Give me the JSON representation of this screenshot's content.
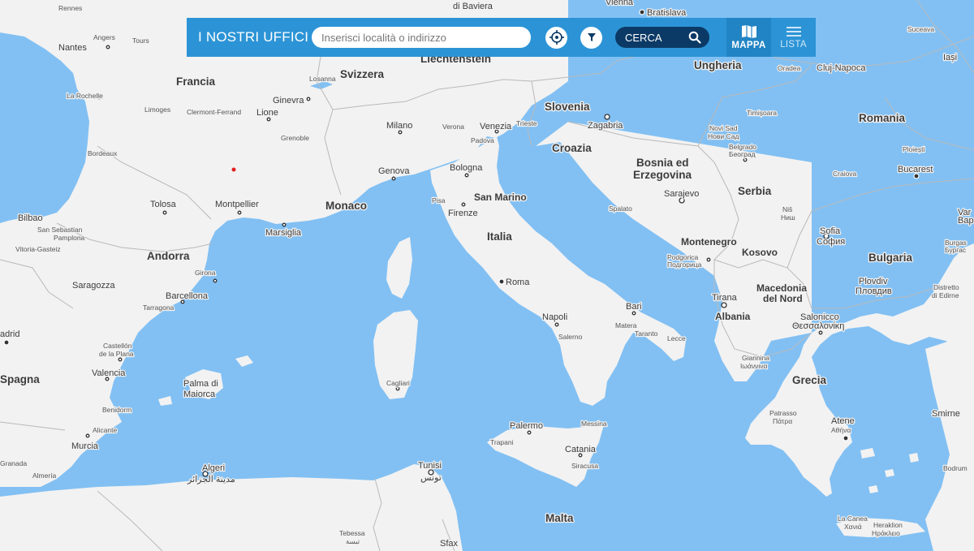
{
  "header": {
    "title": "I NOSTRI UFFICI",
    "search_placeholder": "Inserisci località o indirizzo",
    "search_value": "",
    "cerca_label": "CERCA",
    "tabs": [
      {
        "label": "MAPPA",
        "icon": "map-book-icon",
        "active": true
      },
      {
        "label": "LISTA",
        "icon": "list-icon",
        "active": false
      }
    ],
    "colors": {
      "bar": "#2c94d6",
      "cerca": "#0b3a66",
      "sea": "#82c0f3",
      "land": "#f2f2f2"
    }
  },
  "map": {
    "countries": {
      "francia": "Francia",
      "svizzera": "Svizzera",
      "liechtenstein": "Liechtenstein",
      "ungheria": "Ungheria",
      "romania": "Romania",
      "slovenia": "Slovenia",
      "croazia": "Croazia",
      "bosnia1": "Bosnia ed",
      "bosnia2": "Erzegovina",
      "serbia": "Serbia",
      "monaco": "Monaco",
      "sanmarino": "San Marino",
      "italia": "Italia",
      "andorra": "Andorra",
      "spagna": "Spagna",
      "montenegro": "Montenegro",
      "kosovo": "Kosovo",
      "bulgaria": "Bulgaria",
      "macedonia1": "Macedonia",
      "macedonia2": "del Nord",
      "albania": "Albania",
      "grecia": "Grecia",
      "malta": "Malta"
    },
    "cities": {
      "rennes": "Rennes",
      "dibaviera": "di Baviera",
      "vienna": "Vienna",
      "bratislava": "Bratislava",
      "suceava": "Suceava",
      "iasi": "Iași",
      "angers": "Angers",
      "tours": "Tours",
      "nantes": "Nantes",
      "oradea": "Oradea",
      "clujnapoca": "Cluj-Napoca",
      "losanna": "Losanna",
      "larochelle": "La Rochelle",
      "limoges": "Limoges",
      "clermont": "Clermont-Ferrand",
      "lione": "Lione",
      "ginevra": "Ginevra",
      "milano": "Milano",
      "verona": "Verona",
      "venezia": "Venezia",
      "trieste": "Trieste",
      "padova": "Padova",
      "zagabria": "Zagabria",
      "timisoara": "Timișoara",
      "novisad": "Novi Sad",
      "novisad_n": "Нови Сад",
      "belgrado": "Belgrado",
      "belgrado_n": "Београд",
      "grenoble": "Grenoble",
      "bordeaux": "Bordeaux",
      "genova": "Genova",
      "bologna": "Bologna",
      "ploiesti": "Ploiești",
      "craiova": "Craiova",
      "bucarest": "Bucarest",
      "tolosa": "Tolosa",
      "montpellier": "Montpellier",
      "pisa": "Pisa",
      "firenze": "Firenze",
      "spalato": "Spalato",
      "sarajevo": "Sarajevo",
      "nis": "Niš",
      "nis_n": "Ниш",
      "bilbao": "Bilbao",
      "sansebastian": "San Sebastian",
      "pamplona": "Pamplona",
      "vitoria": "Vitoria-Gasteiz",
      "marsiglia": "Marsiglia",
      "sofia": "Sofia",
      "sofia_n": "София",
      "var": "Var",
      "barn": "Вар",
      "burgas": "Burgas",
      "burgas_n": "Бургас",
      "girona": "Girona",
      "podgorica": "Podgorica",
      "podgorica_n": "Подгорица",
      "roma": "Roma",
      "plovdiv": "Plovdiv",
      "plovdiv_n": "Пловдив",
      "edirne1": "Distretto",
      "edirne2": "di Edirne",
      "saragozza": "Saragozza",
      "barcellona": "Barcellona",
      "tarragona": "Tarragona",
      "tirana": "Tirana",
      "bari": "Bari",
      "napoli": "Napoli",
      "matera": "Matera",
      "taranto": "Taranto",
      "salerno": "Salerno",
      "lecce": "Lecce",
      "salonicco": "Salonicco",
      "salonicco_n": "Θεσσαλονίκη",
      "madrid": "adrid",
      "castellon1": "Castellón",
      "castellon2": "de la Plana",
      "valencia": "Valencia",
      "giannina": "Giannina",
      "giannina_n": "Ιωάννινα",
      "palma1": "Palma di",
      "palma2": "Maiorca",
      "cagliari": "Cagliari",
      "benidorm": "Benidorm",
      "alicante": "Alicante",
      "patrasso": "Patrasso",
      "patrasso_n": "Πάτρα",
      "atene": "Atene",
      "atene_n": "Αθήνα",
      "smirne": "Smirne",
      "palermo": "Palermo",
      "messina": "Messina",
      "trapani": "Trapani",
      "catania": "Catania",
      "murcia": "Murcia",
      "granada": "Granada",
      "siracusa": "Siracusa",
      "almeria": "Almería",
      "algeri": "Algeri",
      "algeri_n": "مدينة الجزائر",
      "tunisi": "Tunisi",
      "tunisi_n": "تونس",
      "bodrum": "Bodrum",
      "lacanea": "La Canea",
      "lacanea_n": "Χανιά",
      "heraklion": "Heraklion",
      "heraklion_n": "Ηράκλειο",
      "tebessa": "Tebessa",
      "tebessa_n": "تبسة",
      "sfax": "Sfax"
    }
  }
}
